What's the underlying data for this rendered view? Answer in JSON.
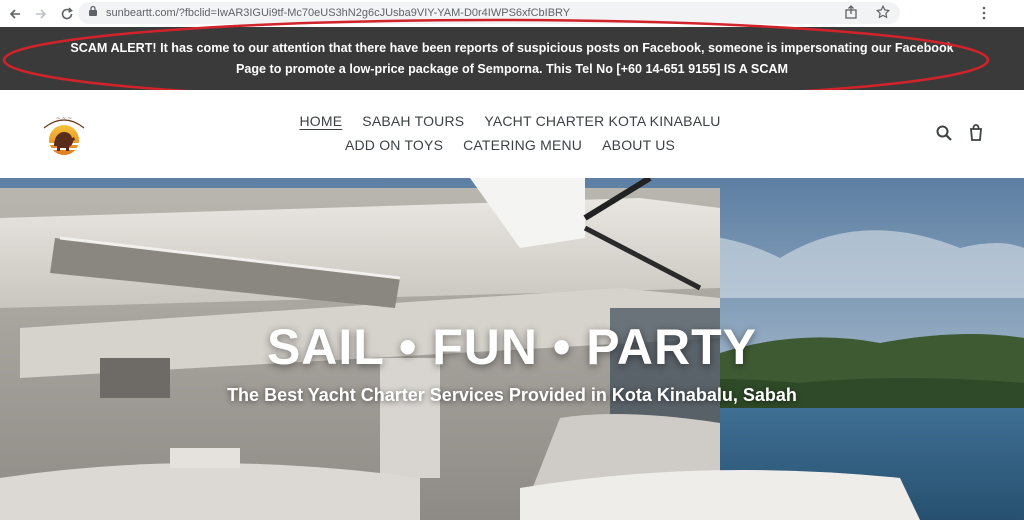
{
  "browser": {
    "url": "sunbeartt.com/?fbclid=IwAR3IGUi9tf-Mc70eUS3hN2g6cJUsba9VIY-YAM-D0r4IWPS6xfCbIBRY"
  },
  "alert": {
    "line1": "SCAM ALERT! It has come to our attention that there have been reports of suspicious posts on Facebook, someone is impersonating our Facebook",
    "line2": "Page to promote a low-price package of Semporna. This Tel No [+60 14-651 9155] IS A SCAM",
    "ellipse_color": "#d2232a"
  },
  "nav": {
    "items": [
      {
        "label": "HOME"
      },
      {
        "label": "SABAH TOURS"
      },
      {
        "label": "YACHT CHARTER KOTA KINABALU"
      },
      {
        "label": "ADD ON TOYS"
      },
      {
        "label": "CATERING MENU"
      },
      {
        "label": "ABOUT US"
      }
    ],
    "active_index": 0
  },
  "hero": {
    "title": "SAIL • FUN • PARTY",
    "subtitle": "The Best Yacht Charter Services Provided in Kota Kinabalu, Sabah"
  },
  "icons": {
    "back": "back-arrow-icon",
    "forward": "forward-arrow-icon",
    "reload": "reload-icon",
    "lock": "lock-icon",
    "share": "share-icon",
    "bookmark": "star-icon",
    "menu": "kebab-menu-icon",
    "search": "search-icon",
    "cart": "cart-icon",
    "logo": "logo-icon"
  }
}
